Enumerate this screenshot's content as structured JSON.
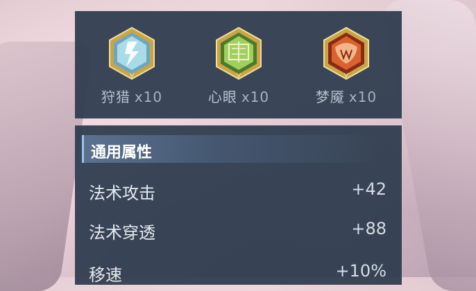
{
  "runes": [
    {
      "name": "狩猎",
      "count": "x10",
      "icon": "hunt-rune-icon"
    },
    {
      "name": "心眼",
      "count": "x10",
      "icon": "insight-rune-icon"
    },
    {
      "name": "梦魇",
      "count": "x10",
      "icon": "nightmare-rune-icon"
    }
  ],
  "attributes": {
    "header": "通用属性",
    "rows": [
      {
        "name": "法术攻击",
        "value": "+42"
      },
      {
        "name": "法术穿透",
        "value": "+88"
      },
      {
        "name": "移速",
        "value": "+10%"
      }
    ]
  }
}
